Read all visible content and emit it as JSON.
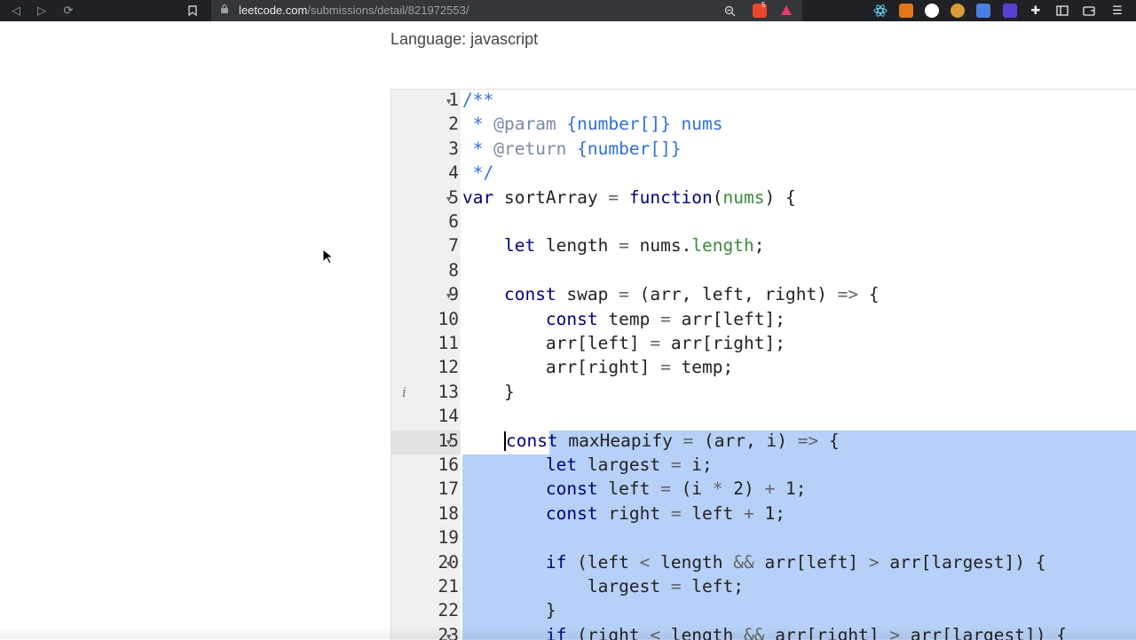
{
  "browser": {
    "url_host": "leetcode.com",
    "url_path": "/submissions/detail/821972553/",
    "shield_badge": "5"
  },
  "page": {
    "language_label": "Language: javascript"
  },
  "editor": {
    "lines": [
      {
        "n": "1",
        "fold": true,
        "tokens": [
          [
            "c",
            "/**"
          ]
        ]
      },
      {
        "n": "2",
        "tokens": [
          [
            "c",
            " * "
          ],
          [
            "cp",
            "@param "
          ],
          [
            "c",
            "{number[]} nums"
          ]
        ]
      },
      {
        "n": "3",
        "tokens": [
          [
            "c",
            " * "
          ],
          [
            "cp",
            "@return "
          ],
          [
            "c",
            "{number[]}"
          ]
        ]
      },
      {
        "n": "4",
        "tokens": [
          [
            "c",
            " */"
          ]
        ]
      },
      {
        "n": "5",
        "fold": true,
        "tokens": [
          [
            "k",
            "var "
          ],
          [
            "t",
            "sortArray "
          ],
          [
            "o",
            "= "
          ],
          [
            "k",
            "function"
          ],
          [
            "t",
            "("
          ],
          [
            "p",
            "nums"
          ],
          [
            "t",
            ") {"
          ]
        ]
      },
      {
        "n": "6",
        "tokens": []
      },
      {
        "n": "7",
        "tokens": [
          [
            "t",
            "    "
          ],
          [
            "k",
            "let "
          ],
          [
            "t",
            "length "
          ],
          [
            "o",
            "= "
          ],
          [
            "t",
            "nums."
          ],
          [
            "p",
            "length"
          ],
          [
            "t",
            ";"
          ]
        ]
      },
      {
        "n": "8",
        "tokens": []
      },
      {
        "n": "9",
        "fold": true,
        "tokens": [
          [
            "t",
            "    "
          ],
          [
            "k",
            "const "
          ],
          [
            "t",
            "swap "
          ],
          [
            "o",
            "= "
          ],
          [
            "t",
            "(arr, left, right) "
          ],
          [
            "o",
            "=> "
          ],
          [
            "t",
            "{"
          ]
        ]
      },
      {
        "n": "10",
        "tokens": [
          [
            "t",
            "        "
          ],
          [
            "k",
            "const "
          ],
          [
            "t",
            "temp "
          ],
          [
            "o",
            "= "
          ],
          [
            "t",
            "arr[left];"
          ]
        ]
      },
      {
        "n": "11",
        "tokens": [
          [
            "t",
            "        arr[left] "
          ],
          [
            "o",
            "= "
          ],
          [
            "t",
            "arr[right];"
          ]
        ]
      },
      {
        "n": "12",
        "tokens": [
          [
            "t",
            "        arr[right] "
          ],
          [
            "o",
            "= "
          ],
          [
            "t",
            "temp;"
          ]
        ]
      },
      {
        "n": "13",
        "info": true,
        "tokens": [
          [
            "t",
            "    }"
          ]
        ]
      },
      {
        "n": "14",
        "tokens": []
      },
      {
        "n": "15",
        "fold": true,
        "active": true,
        "tokens": [
          [
            "t",
            "    "
          ],
          [
            "cur",
            ""
          ],
          [
            "k",
            "const "
          ],
          [
            "t",
            "maxHeapify "
          ],
          [
            "o",
            "= "
          ],
          [
            "t",
            "(arr, i) "
          ],
          [
            "o",
            "=> "
          ],
          [
            "t",
            "{"
          ]
        ]
      },
      {
        "n": "16",
        "tokens": [
          [
            "t",
            "        "
          ],
          [
            "k",
            "let "
          ],
          [
            "t",
            "largest "
          ],
          [
            "o",
            "= "
          ],
          [
            "t",
            "i;"
          ]
        ]
      },
      {
        "n": "17",
        "tokens": [
          [
            "t",
            "        "
          ],
          [
            "k",
            "const "
          ],
          [
            "t",
            "left "
          ],
          [
            "o",
            "= "
          ],
          [
            "t",
            "(i "
          ],
          [
            "o",
            "* "
          ],
          [
            "t",
            "2) "
          ],
          [
            "o",
            "+ "
          ],
          [
            "t",
            "1;"
          ]
        ]
      },
      {
        "n": "18",
        "tokens": [
          [
            "t",
            "        "
          ],
          [
            "k",
            "const "
          ],
          [
            "t",
            "right "
          ],
          [
            "o",
            "= "
          ],
          [
            "t",
            "left "
          ],
          [
            "o",
            "+ "
          ],
          [
            "t",
            "1;"
          ]
        ]
      },
      {
        "n": "19",
        "tokens": []
      },
      {
        "n": "20",
        "fold": true,
        "tokens": [
          [
            "t",
            "        "
          ],
          [
            "k",
            "if "
          ],
          [
            "t",
            "(left "
          ],
          [
            "o",
            "< "
          ],
          [
            "t",
            "length "
          ],
          [
            "o",
            "&& "
          ],
          [
            "t",
            "arr[left] "
          ],
          [
            "o",
            "> "
          ],
          [
            "t",
            "arr[largest]) {"
          ]
        ]
      },
      {
        "n": "21",
        "tokens": [
          [
            "t",
            "            largest "
          ],
          [
            "o",
            "= "
          ],
          [
            "t",
            "left;"
          ]
        ]
      },
      {
        "n": "22",
        "tokens": [
          [
            "t",
            "        }"
          ]
        ]
      },
      {
        "n": "23",
        "fold": true,
        "tokens": [
          [
            "t",
            "        "
          ],
          [
            "k",
            "if "
          ],
          [
            "t",
            "(right "
          ],
          [
            "o",
            "< "
          ],
          [
            "t",
            "length "
          ],
          [
            "o",
            "&& "
          ],
          [
            "t",
            "arr[right] "
          ],
          [
            "o",
            "> "
          ],
          [
            "t",
            "arr[largest]) {"
          ]
        ]
      }
    ]
  }
}
